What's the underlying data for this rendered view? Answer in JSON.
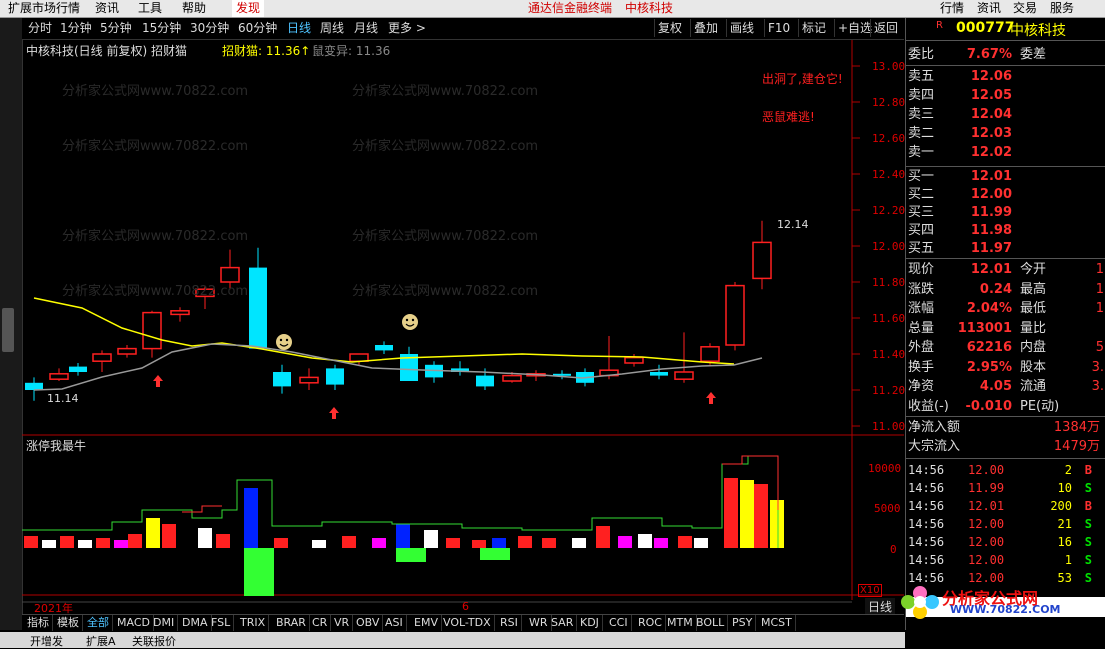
{
  "menu": {
    "items": [
      "扩展市场行情",
      "资讯",
      "工具",
      "帮助",
      "发现"
    ],
    "center": [
      "通达信金融终端",
      "中核科技"
    ],
    "right": [
      "行情",
      "资讯",
      "交易",
      "服务"
    ]
  },
  "periods": [
    "分时",
    "1分钟",
    "5分钟",
    "15分钟",
    "30分钟",
    "60分钟",
    "日线",
    "周线",
    "月线",
    "更多 >"
  ],
  "active_period": "日线",
  "toolbar": [
    "复权",
    "叠加",
    "画线",
    "F10",
    "标记",
    "+自选",
    "返回"
  ],
  "chart": {
    "title": "中核科技(日线 前复权) 招财猫",
    "indicator1_label": "招财猫: 11.36↑",
    "indicator2_label": "鼠变异: 11.36",
    "y_ticks": [
      "13.00",
      "12.80",
      "12.60",
      "12.40",
      "12.20",
      "12.00",
      "11.80",
      "11.60",
      "11.40",
      "11.20",
      "11.00"
    ],
    "annotation_1": "出洞了,建仓它!",
    "annotation_2": "恶鼠难逃!",
    "high_label": "12.14",
    "low_label": "11.14",
    "watermark": "分析家公式网www.70822.com",
    "sub_title": "涨停我最牛",
    "sub_ticks": [
      "10000",
      "5000",
      "0"
    ],
    "x_year": "2021年",
    "x_month": "6",
    "x10": "X10"
  },
  "quote": {
    "code": "000777",
    "name": "中核科技",
    "r_mark": "R",
    "webi_label": "委比",
    "webi": "7.67%",
    "wecha_label": "委差",
    "asks": [
      [
        "卖五",
        "12.06"
      ],
      [
        "卖四",
        "12.05"
      ],
      [
        "卖三",
        "12.04"
      ],
      [
        "卖二",
        "12.03"
      ],
      [
        "卖一",
        "12.02"
      ]
    ],
    "bids": [
      [
        "买一",
        "12.01"
      ],
      [
        "买二",
        "12.00"
      ],
      [
        "买三",
        "11.99"
      ],
      [
        "买四",
        "11.98"
      ],
      [
        "买五",
        "11.97"
      ]
    ],
    "stats": [
      [
        "现价",
        "12.01",
        "今开",
        "1"
      ],
      [
        "涨跌",
        "0.24",
        "最高",
        "1"
      ],
      [
        "涨幅",
        "2.04%",
        "最低",
        "1"
      ],
      [
        "总量",
        "113001",
        "量比",
        ""
      ],
      [
        "外盘",
        "62216",
        "内盘",
        "5"
      ],
      [
        "换手",
        "2.95%",
        "股本",
        "3."
      ],
      [
        "净资",
        "4.05",
        "流通",
        "3."
      ],
      [
        "收益(-)",
        "-0.010",
        "PE(动)",
        ""
      ]
    ],
    "inflow_label": "净流入额",
    "inflow": "1384万",
    "block_label": "大宗流入",
    "block": "1479万",
    "ticks": [
      [
        "14:56",
        "12.00",
        "2",
        "B"
      ],
      [
        "14:56",
        "11.99",
        "10",
        "S"
      ],
      [
        "14:56",
        "12.01",
        "200",
        "B"
      ],
      [
        "14:56",
        "12.00",
        "21",
        "S"
      ],
      [
        "14:56",
        "12.00",
        "16",
        "S"
      ],
      [
        "14:56",
        "12.00",
        "1",
        "S"
      ],
      [
        "14:56",
        "12.00",
        "53",
        "S"
      ]
    ],
    "daily_btn": "日线"
  },
  "logo": {
    "text": "分析家公式网",
    "url": "WWW.70822.COM"
  },
  "indicators": [
    "指标",
    "模板",
    "全部",
    "MACD",
    "DMI",
    "DMA",
    "FSL",
    "TRIX",
    "BRAR",
    "CR",
    "VR",
    "OBV",
    "ASI",
    "EMV",
    "VOL-TDX",
    "RSI",
    "WR",
    "SAR",
    "KDJ",
    "CCI",
    "ROC",
    "MTM",
    "BOLL",
    "PSY",
    "MCST"
  ],
  "active_indicator": "全部",
  "statusbar": [
    "开增发",
    "扩展A",
    "关联报价"
  ],
  "colors": {
    "up": "#ff2020",
    "down": "#00e5ff",
    "ma": "#ffff00",
    "accent": "#4fc3ff"
  }
}
